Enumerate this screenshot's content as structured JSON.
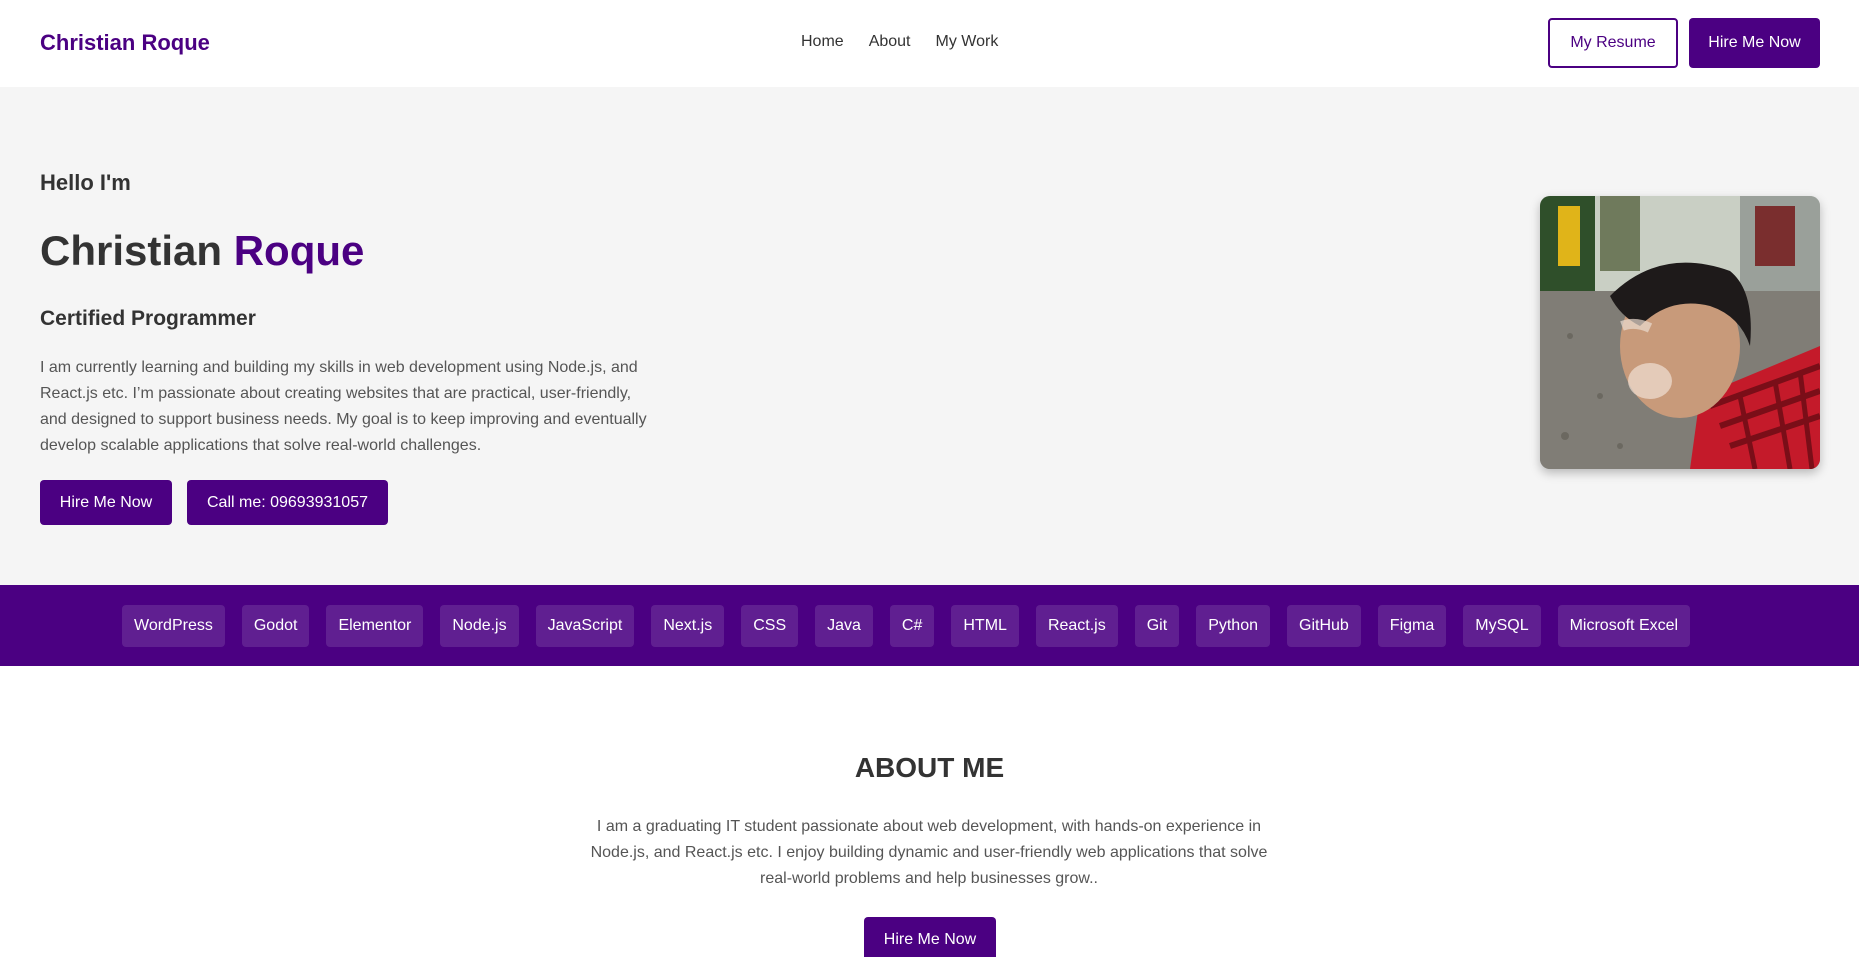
{
  "header": {
    "logo": "Christian Roque",
    "nav": [
      "Home",
      "About",
      "My Work"
    ],
    "resume_label": "My Resume",
    "hire_label": "Hire Me Now"
  },
  "hero": {
    "greeting": "Hello I'm",
    "first_name": "Christian",
    "last_name": "Roque",
    "role": "Certified Programmer",
    "intro": "I am currently learning and building my skills in web development using Node.js, and React.js etc. I’m passionate about creating websites that are practical, user-friendly, and designed to support business needs. My goal is to keep improving and eventually develop scalable applications that solve real-world challenges.",
    "hire_label": "Hire Me Now",
    "call_label": "Call me: 09693931057"
  },
  "skills": [
    "WordPress",
    "Godot",
    "Elementor",
    "Node.js",
    "JavaScript",
    "Next.js",
    "CSS",
    "Java",
    "C#",
    "HTML",
    "React.js",
    "Git",
    "Python",
    "GitHub",
    "Figma",
    "MySQL",
    "Microsoft Excel"
  ],
  "about": {
    "title": "ABOUT ME",
    "text": "I am a graduating IT student passionate about web development, with hands-on experience in Node.js, and React.js etc. I enjoy building dynamic and user-friendly web applications that solve real-world problems and help businesses grow..",
    "hire_label": "Hire Me Now"
  },
  "colors": {
    "accent": "#4b0082",
    "hero_bg": "#f5f5f5"
  }
}
